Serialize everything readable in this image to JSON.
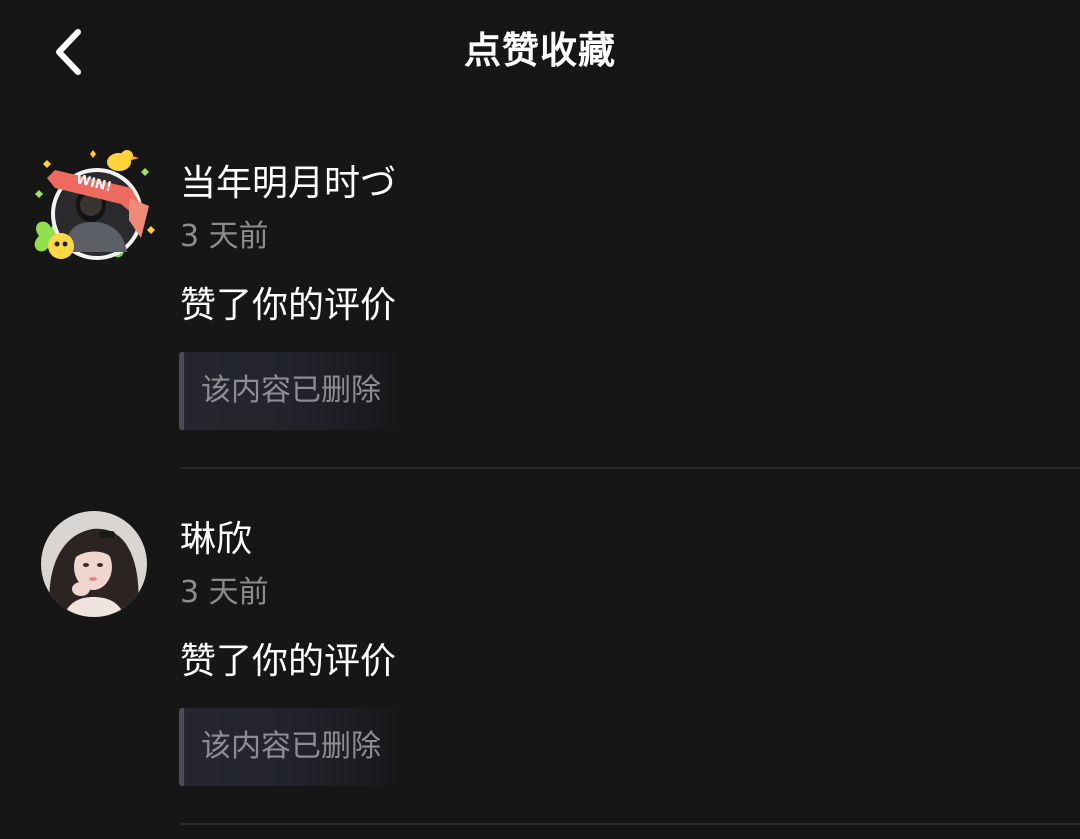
{
  "header": {
    "title": "点赞收藏",
    "back_icon": "chevron-left-icon"
  },
  "notifications": [
    {
      "username": "当年明月时づ",
      "time": "3 天前",
      "action": "赞了你的评价",
      "quoted": "该内容已删除",
      "avatar_text": "WIN!"
    },
    {
      "username": "琳欣",
      "time": "3 天前",
      "action": "赞了你的评价",
      "quoted": "该内容已删除"
    }
  ],
  "colors": {
    "background": "#161616",
    "primary_text": "#ffffff",
    "secondary_text": "#8c8c8c",
    "quote_background": "#25262d",
    "divider": "#2a2a2a"
  }
}
